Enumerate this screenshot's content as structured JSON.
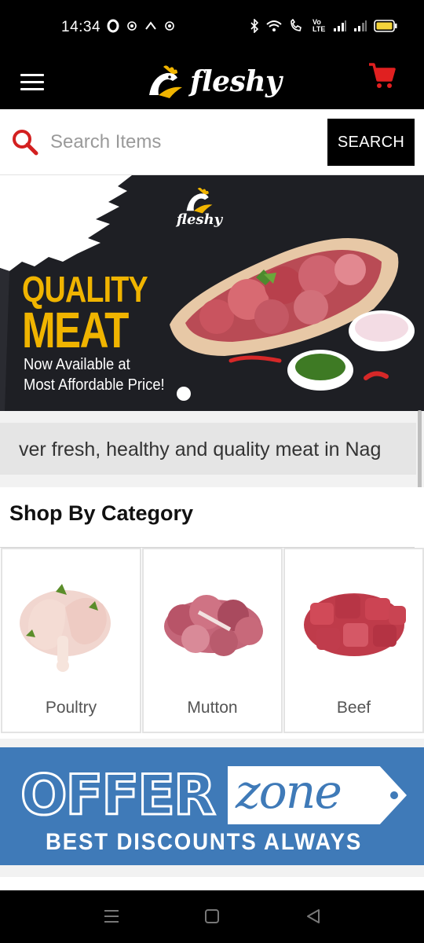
{
  "status_bar": {
    "time": "14:34",
    "left_icons": [
      "o-icon",
      "notification-icon",
      "notification-icon",
      "notification-icon"
    ],
    "right_icons": [
      "bluetooth-icon",
      "wifi-icon",
      "call-wifi-icon",
      "volte-icon",
      "signal-icon",
      "signal-icon",
      "battery-icon"
    ],
    "volte_label": "Vo LTE"
  },
  "app_bar": {
    "brand": "fleshy",
    "accent_color": "#e02020"
  },
  "search": {
    "placeholder": "Search Items",
    "button_label": "SEARCH"
  },
  "banner": {
    "logo_text": "fleshy",
    "headline_line1": "QUALITY",
    "headline_line2": "MEAT",
    "subline1": "Now Available at",
    "subline2": "Most Affordable Price!",
    "active_slide": 1,
    "headline_color": "#f0b400"
  },
  "marquee": {
    "text": "ver fresh, healthy and quality meat in Nag"
  },
  "categories": {
    "title": "Shop By Category",
    "items": [
      {
        "label": "Poultry"
      },
      {
        "label": "Mutton"
      },
      {
        "label": "Beef"
      }
    ]
  },
  "offer": {
    "word1": "OFFER",
    "word2": "zone",
    "subtitle": "BEST DISCOUNTS ALWAYS",
    "bg_color": "#3f7ab8"
  },
  "nav": {
    "buttons": [
      "menu-icon",
      "home-icon",
      "back-icon"
    ]
  }
}
